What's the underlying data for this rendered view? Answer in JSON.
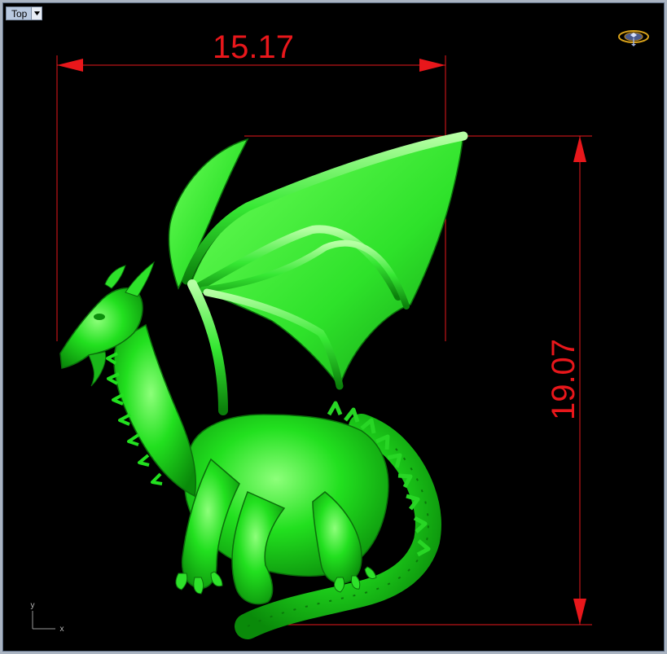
{
  "viewport": {
    "view_name": "Top",
    "background_color": "#000000"
  },
  "dimensions": {
    "width_label": "15.17",
    "height_label": "19.07",
    "color": "#e8171b"
  },
  "model": {
    "color": "#1ed81e",
    "icon": "dragon-model"
  },
  "axes": {
    "x_label": "x",
    "y_label": "y"
  },
  "widget": {
    "icon": "gumball-navigation-icon"
  }
}
